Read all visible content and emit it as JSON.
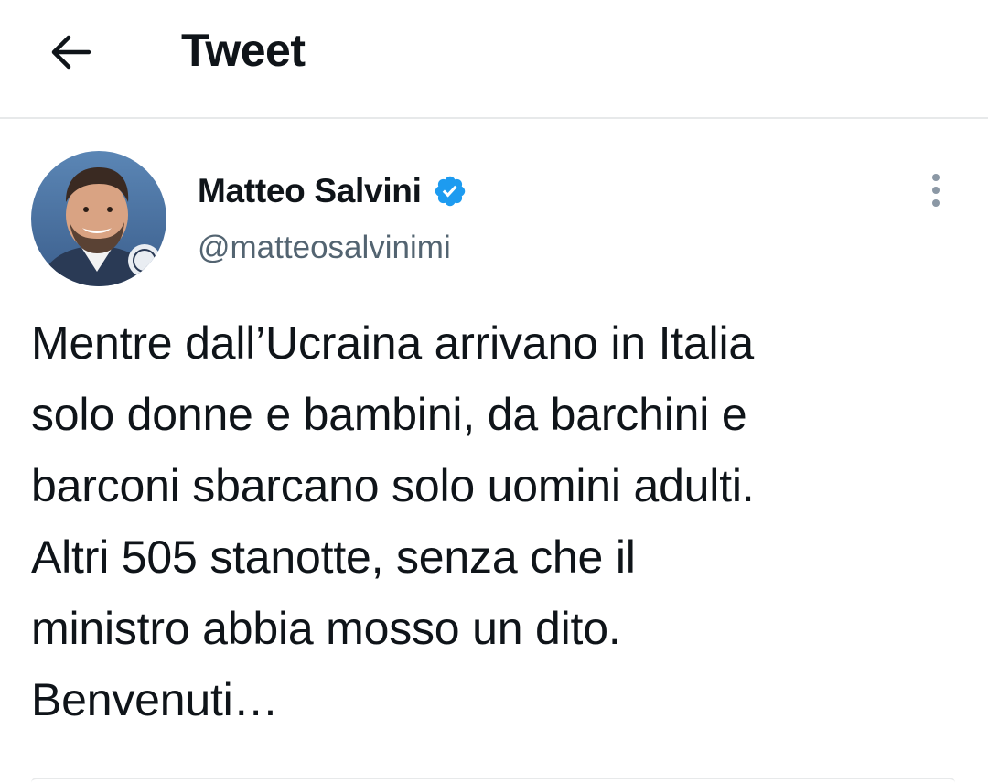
{
  "header": {
    "back_icon": "arrow-left-icon",
    "title": "Tweet"
  },
  "tweet": {
    "author": {
      "name": "Matteo Salvini",
      "handle": "@matteosalvinimi",
      "verified": true,
      "verified_icon": "verified-badge-icon"
    },
    "more_icon": "more-vertical-icon",
    "text": "Mentre dall’Ucraina arrivano in Italia\nsolo donne e bambini, da barchini e\nbarconi sbarcano solo uomini adulti.\nAltri 505 stanotte, senza che il\nministro abbia mosso un dito.\nBenvenuti…"
  },
  "colors": {
    "text_primary": "#0f1419",
    "text_secondary": "#536471",
    "verified_blue": "#1d9bf0",
    "divider": "#e7e9ea"
  }
}
